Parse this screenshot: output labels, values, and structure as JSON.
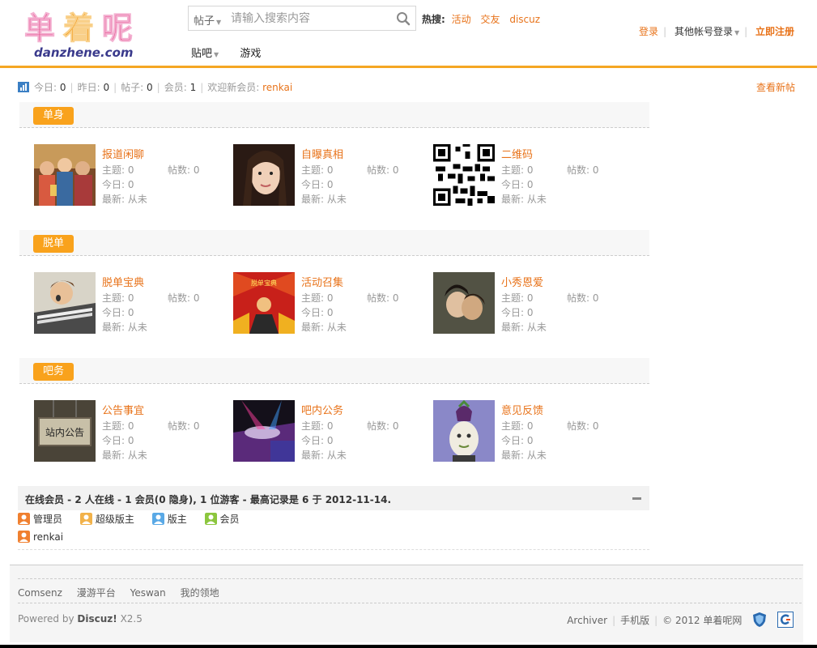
{
  "header": {
    "logo_text": "单着呢",
    "logo_domain": "danzhene.com",
    "search": {
      "scope": "帖子",
      "placeholder": "请输入搜索内容"
    },
    "hot": {
      "label": "热搜:",
      "links": [
        "活动",
        "交友",
        "discuz"
      ]
    },
    "nav": [
      "贴吧",
      "游戏"
    ],
    "user": {
      "login": "登录",
      "other_login": "其他帐号登录",
      "register": "立即注册"
    }
  },
  "stats": {
    "today_label": "今日:",
    "today": "0",
    "yesterday_label": "昨日:",
    "yesterday": "0",
    "posts_label": "帖子:",
    "posts": "0",
    "members_label": "会员:",
    "members": "1",
    "welcome_label": "欢迎新会员:",
    "new_member": "renkai",
    "new_posts_link": "查看新帖"
  },
  "categories": [
    {
      "title": "单身",
      "forums": [
        {
          "name": "报道闲聊",
          "topics_label": "主题:",
          "topics": "0",
          "posts_label": "帖数:",
          "posts": "0",
          "today_label": "今日:",
          "today": "0",
          "latest_label": "最新:",
          "latest": "从未",
          "thumb": "people-at-bar"
        },
        {
          "name": "自曝真相",
          "topics_label": "主题:",
          "topics": "0",
          "posts_label": "帖数:",
          "posts": "0",
          "today_label": "今日:",
          "today": "0",
          "latest_label": "最新:",
          "latest": "从未",
          "thumb": "girl-portrait"
        },
        {
          "name": "二维码",
          "topics_label": "主题:",
          "topics": "0",
          "posts_label": "帖数:",
          "posts": "0",
          "today_label": "今日:",
          "today": "0",
          "latest_label": "最新:",
          "latest": "从未",
          "thumb": "qr-code"
        }
      ]
    },
    {
      "title": "脱单",
      "forums": [
        {
          "name": "脱单宝典",
          "topics_label": "主题:",
          "topics": "0",
          "posts_label": "帖数:",
          "posts": "0",
          "today_label": "今日:",
          "today": "0",
          "latest_label": "最新:",
          "latest": "从未",
          "thumb": "person-with-book"
        },
        {
          "name": "活动召集",
          "topics_label": "主题:",
          "topics": "0",
          "posts_label": "帖数:",
          "posts": "0",
          "today_label": "今日:",
          "today": "0",
          "latest_label": "最新:",
          "latest": "从未",
          "thumb": "red-poster",
          "thumb_text": "脱单宝典"
        },
        {
          "name": "小秀恩爱",
          "topics_label": "主题:",
          "topics": "0",
          "posts_label": "帖数:",
          "posts": "0",
          "today_label": "今日:",
          "today": "0",
          "latest_label": "最新:",
          "latest": "从未",
          "thumb": "couple"
        }
      ]
    },
    {
      "title": "吧务",
      "forums": [
        {
          "name": "公告事宜",
          "topics_label": "主题:",
          "topics": "0",
          "posts_label": "帖数:",
          "posts": "0",
          "today_label": "今日:",
          "today": "0",
          "latest_label": "最新:",
          "latest": "从未",
          "thumb": "notice-sign",
          "thumb_text": "站内公告"
        },
        {
          "name": "吧内公务",
          "topics_label": "主题:",
          "topics": "0",
          "posts_label": "帖数:",
          "posts": "0",
          "today_label": "今日:",
          "today": "0",
          "latest_label": "最新:",
          "latest": "从未",
          "thumb": "stage-lights"
        },
        {
          "name": "意见反馈",
          "topics_label": "主题:",
          "topics": "0",
          "posts_label": "帖数:",
          "posts": "0",
          "today_label": "今日:",
          "today": "0",
          "latest_label": "最新:",
          "latest": "从未",
          "thumb": "eggplant-figure"
        }
      ]
    }
  ],
  "online": {
    "summary": "在线会员 - 2 人在线 - 1 会员(0 隐身), 1 位游客 - 最高记录是 6 于 2012-11-14.",
    "legend": [
      {
        "label": "管理员",
        "color": "#f08030",
        "icon": "user-icon"
      },
      {
        "label": "超级版主",
        "color": "#f2b24a",
        "icon": "user-icon"
      },
      {
        "label": "版主",
        "color": "#5aa9e6",
        "icon": "user-icon"
      },
      {
        "label": "会员",
        "color": "#8cc63e",
        "icon": "user-icon"
      }
    ],
    "users": [
      {
        "name": "renkai",
        "color": "#f08030"
      }
    ]
  },
  "footer": {
    "links": [
      "Comsenz",
      "漫游平台",
      "Yeswan",
      "我的领地"
    ],
    "powered_prefix": "Powered by",
    "powered_brand": "Discuz!",
    "powered_version": "X2.5",
    "right_links": [
      "Archiver",
      "手机版"
    ],
    "copyright": "© 2012 单着呢网"
  },
  "colors": {
    "accent": "#e8731a",
    "category_tag": "#f9a21c",
    "header_border": "#f5a623"
  }
}
